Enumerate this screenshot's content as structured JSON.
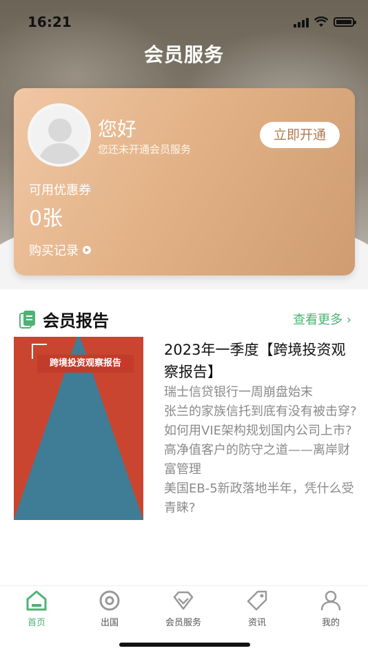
{
  "status_bar": {
    "time": "16:21"
  },
  "header": {
    "title": "会员服务"
  },
  "member_card": {
    "greeting": "您好",
    "subtitle": "您还未开通会员服务",
    "open_button": "立即开通",
    "coupon_label": "可用优惠券",
    "coupon_value": "0张",
    "records_link": "购买记录"
  },
  "reports": {
    "section_title": "会员报告",
    "more_link": "查看更多",
    "cover_title": "跨境投资观察报告",
    "article_title": "2023年一季度【跨境投资观察报告】",
    "items": [
      "瑞士信贷银行一周崩盘始末",
      "张兰的家族信托到底有没有被击穿?",
      "如何用VIE架构规划国内公司上市?",
      "高净值客户的防守之道——离岸财富管理",
      "美国EB-5新政落地半年，凭什么受青睐?"
    ]
  },
  "tabbar": {
    "items": [
      {
        "label": "首页",
        "icon": "home-icon",
        "active": true
      },
      {
        "label": "出国",
        "icon": "target-icon",
        "active": false
      },
      {
        "label": "会员服务",
        "icon": "diamond-icon",
        "active": false
      },
      {
        "label": "资讯",
        "icon": "tag-icon",
        "active": false
      },
      {
        "label": "我的",
        "icon": "person-icon",
        "active": false
      }
    ]
  },
  "colors": {
    "accent": "#4cb374",
    "card": "#e3b287"
  }
}
